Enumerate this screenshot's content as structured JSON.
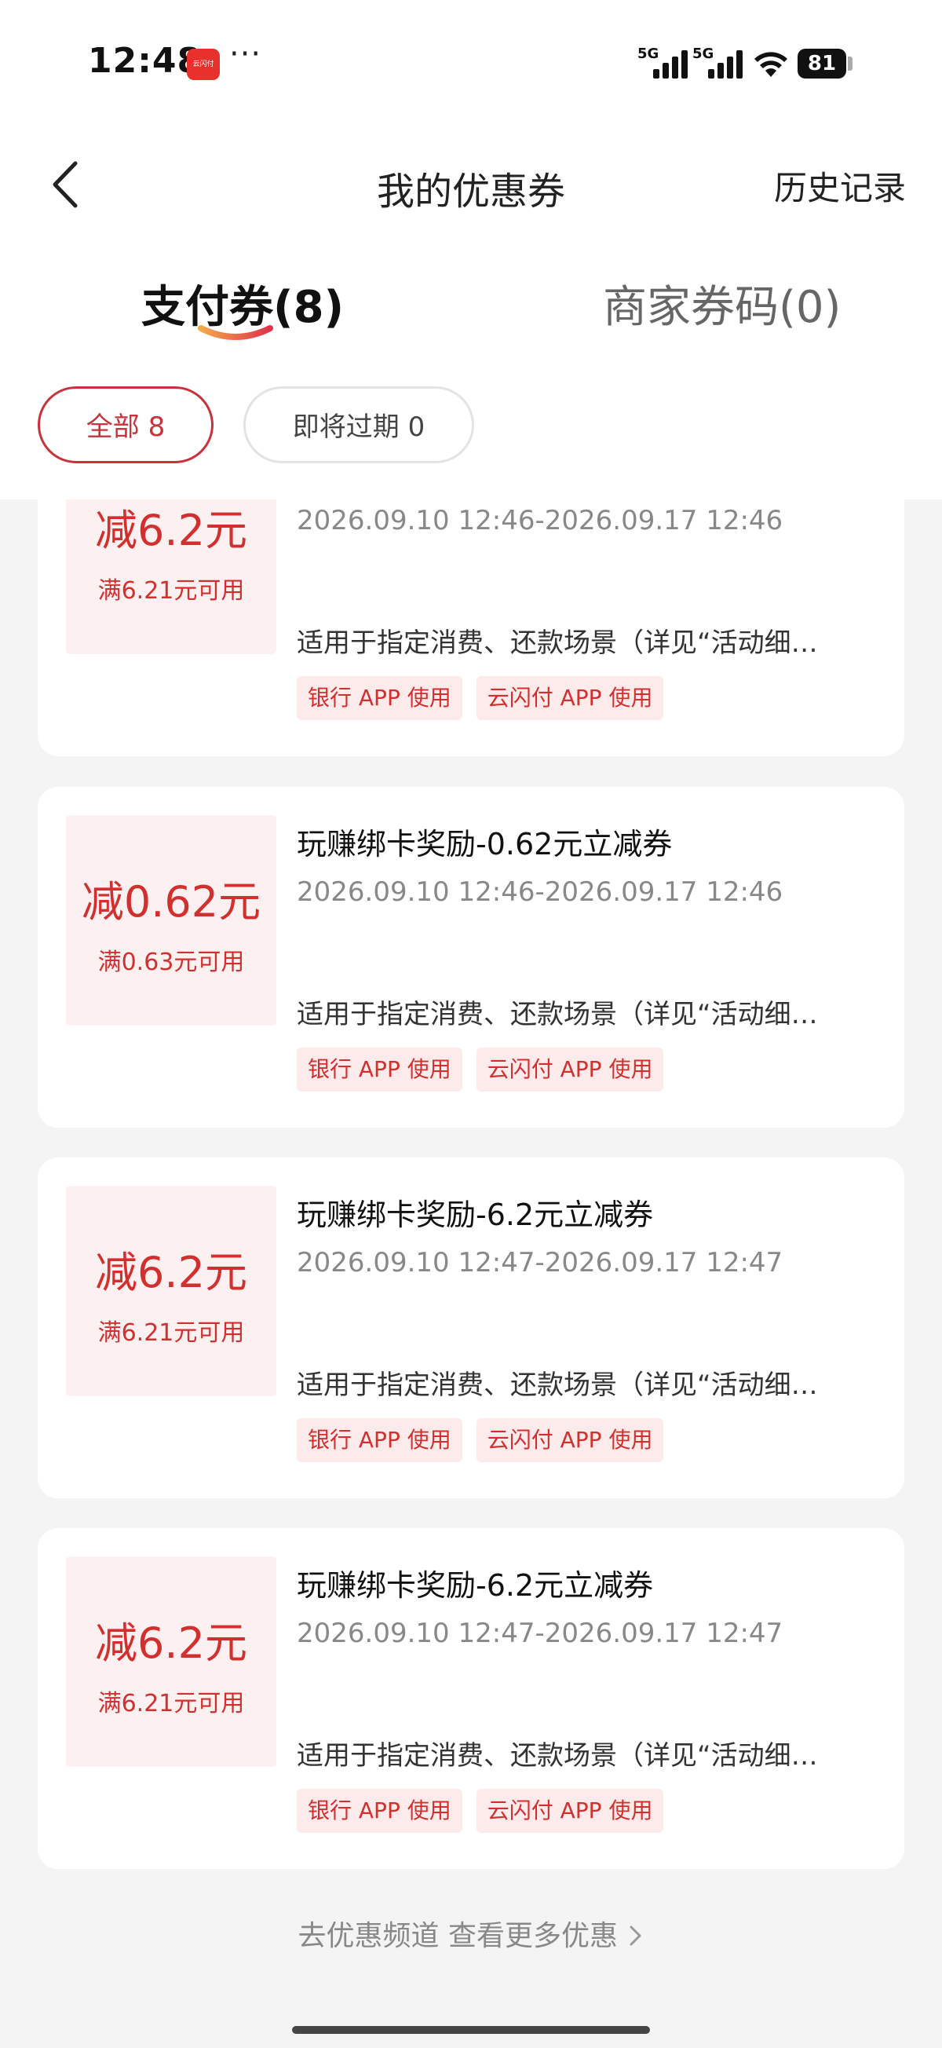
{
  "status_bar": {
    "time": "12:48",
    "app_icon_text": "云闪付",
    "overflow_dots": "···",
    "signal_1_label": "5G",
    "signal_2_label": "5G",
    "battery_level": "81"
  },
  "header": {
    "title": "我的优惠券",
    "history_label": "历史记录"
  },
  "tabs": [
    {
      "label": "支付券(8)",
      "active": true
    },
    {
      "label": "商家券码(0)",
      "active": false
    }
  ],
  "filters": [
    {
      "label": "全部 8",
      "selected": true
    },
    {
      "label": "即将过期 0",
      "selected": false
    }
  ],
  "coupons": [
    {
      "amount_prefix": "减",
      "amount_value": "6.2",
      "amount_unit": "元",
      "min_spend": "满6.21元可用",
      "name": "",
      "dates": "2026.09.10 12:46-2026.09.17 12:46",
      "scene": "适用于指定消费、还款场景（详见“活动细…",
      "tags": [
        "银行 APP 使用",
        "云闪付 APP 使用"
      ]
    },
    {
      "amount_prefix": "减",
      "amount_value": "0.62",
      "amount_unit": "元",
      "min_spend": "满0.63元可用",
      "name": "玩赚绑卡奖励-0.62元立减券",
      "dates": "2026.09.10 12:46-2026.09.17 12:46",
      "scene": "适用于指定消费、还款场景（详见“活动细…",
      "tags": [
        "银行 APP 使用",
        "云闪付 APP 使用"
      ]
    },
    {
      "amount_prefix": "减",
      "amount_value": "6.2",
      "amount_unit": "元",
      "min_spend": "满6.21元可用",
      "name": "玩赚绑卡奖励-6.2元立减券",
      "dates": "2026.09.10 12:47-2026.09.17 12:47",
      "scene": "适用于指定消费、还款场景（详见“活动细…",
      "tags": [
        "银行 APP 使用",
        "云闪付 APP 使用"
      ]
    },
    {
      "amount_prefix": "减",
      "amount_value": "6.2",
      "amount_unit": "元",
      "min_spend": "满6.21元可用",
      "name": "玩赚绑卡奖励-6.2元立减券",
      "dates": "2026.09.10 12:47-2026.09.17 12:47",
      "scene": "适用于指定消费、还款场景（详见“活动细…",
      "tags": [
        "银行 APP 使用",
        "云闪付 APP 使用"
      ]
    }
  ],
  "footer": {
    "link_text": "去优惠频道 查看更多优惠"
  },
  "colors": {
    "accent": "#d22f2f",
    "chip_border": "#c8323c",
    "amount_bg": "#fdf0f0",
    "tag_bg": "#fdeaea",
    "page_bg": "#f4f4f4"
  }
}
